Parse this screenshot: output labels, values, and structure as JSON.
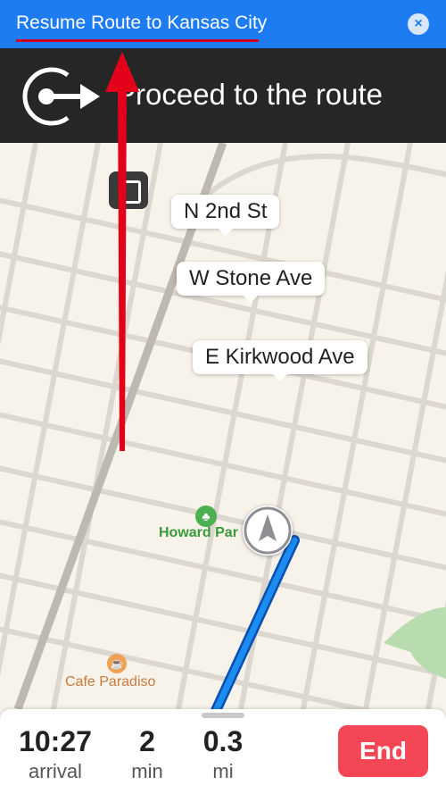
{
  "banner": {
    "title": "Resume Route to Kansas City",
    "close_icon": "close-icon"
  },
  "navigation": {
    "instruction": "Proceed to the route",
    "icon": "proceed-to-route-icon"
  },
  "map": {
    "street_labels": [
      "N 2nd St",
      "W Stone Ave",
      "E Kirkwood Ave"
    ],
    "poi": {
      "park": "Howard Par",
      "cafe": "Cafe Paradiso"
    }
  },
  "trip": {
    "arrival_time": "10:27",
    "arrival_label": "arrival",
    "minutes": "2",
    "minutes_label": "min",
    "distance": "0.3",
    "distance_label": "mi"
  },
  "actions": {
    "end_label": "End"
  },
  "colors": {
    "banner": "#1d7cf2",
    "nav_bar": "#262626",
    "route": "#1c6fe0",
    "end_button": "#f44654",
    "annotation": "#d0021b"
  }
}
